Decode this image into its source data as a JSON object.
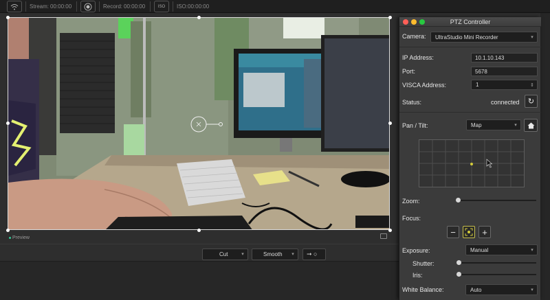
{
  "topbar": {
    "stream_label": "Stream:",
    "stream_time": "00:00:00",
    "record_label": "Record:",
    "record_time": "00:00:00",
    "iso_label": "ISO:",
    "iso_time": "00:00:00",
    "iso_icon_text": "ISO"
  },
  "preview": {
    "label": "Preview"
  },
  "bottombar": {
    "cut_label": "Cut",
    "smooth_label": "Smooth",
    "go_label": "➞ ○"
  },
  "ptz": {
    "title": "PTZ Controller",
    "camera_label": "Camera:",
    "camera_value": "UltraStudio Mini Recorder",
    "ip_label": "IP Address:",
    "ip_value": "10.1.10.143",
    "port_label": "Port:",
    "port_value": "5678",
    "visca_label": "VISCA Address:",
    "visca_value": "1",
    "status_label": "Status:",
    "status_value": "connected",
    "pan_tilt_label": "Pan / Tilt:",
    "pan_tilt_mode": "Map",
    "zoom_label": "Zoom:",
    "zoom_level": 0.0,
    "focus_label": "Focus:",
    "focus_minus": "−",
    "focus_plus": "+",
    "exposure_label": "Exposure:",
    "exposure_value": "Manual",
    "shutter_label": "Shutter:",
    "shutter_level": 0.0,
    "iris_label": "Iris:",
    "iris_level": 0.0,
    "wb_label": "White Balance:",
    "wb_value": "Auto"
  },
  "colors": {
    "traffic_red": "#ff5f57",
    "traffic_yellow": "#febc2e",
    "traffic_green": "#28c840",
    "pan_tilt_dot": "#d4cc3a"
  }
}
